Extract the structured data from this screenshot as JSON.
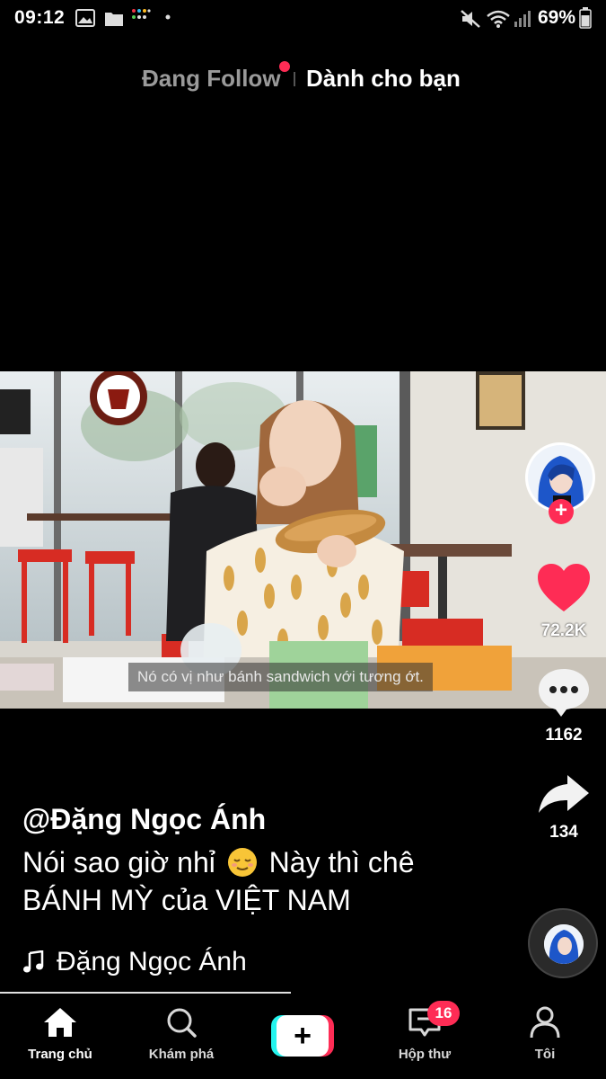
{
  "status_bar": {
    "time": "09:12",
    "battery_percent": "69%",
    "icons": [
      "gallery-icon",
      "folder-icon",
      "app-dots-icon",
      "dot-icon",
      "mute-icon",
      "wifi-icon",
      "signal-icon",
      "battery-icon"
    ]
  },
  "feed_tabs": {
    "following": "Đang Follow",
    "for_you": "Dành cho bạn",
    "active": "for_you"
  },
  "video": {
    "subtitle": "Nó có vị như bánh sandwich với tương ớt."
  },
  "actions": {
    "likes": "72.2K",
    "comments": "1162",
    "shares": "134"
  },
  "post": {
    "author": "@Đặng Ngọc Ánh",
    "caption_line1_before_emoji": "Nói sao giờ nhỉ",
    "caption_line1_after_emoji": "Này thì chê",
    "caption_line2": "BÁNH MỲ của VIỆT NAM",
    "music": "Đặng Ngọc Ánh"
  },
  "playback": {
    "progress": 0.48
  },
  "bottom_nav": {
    "home": "Trang chủ",
    "discover": "Khám phá",
    "inbox": "Hộp thư",
    "inbox_badge": "16",
    "profile": "Tôi"
  },
  "colors": {
    "accent": "#fe2c55",
    "cyan": "#25f4ee",
    "background": "#000000"
  }
}
